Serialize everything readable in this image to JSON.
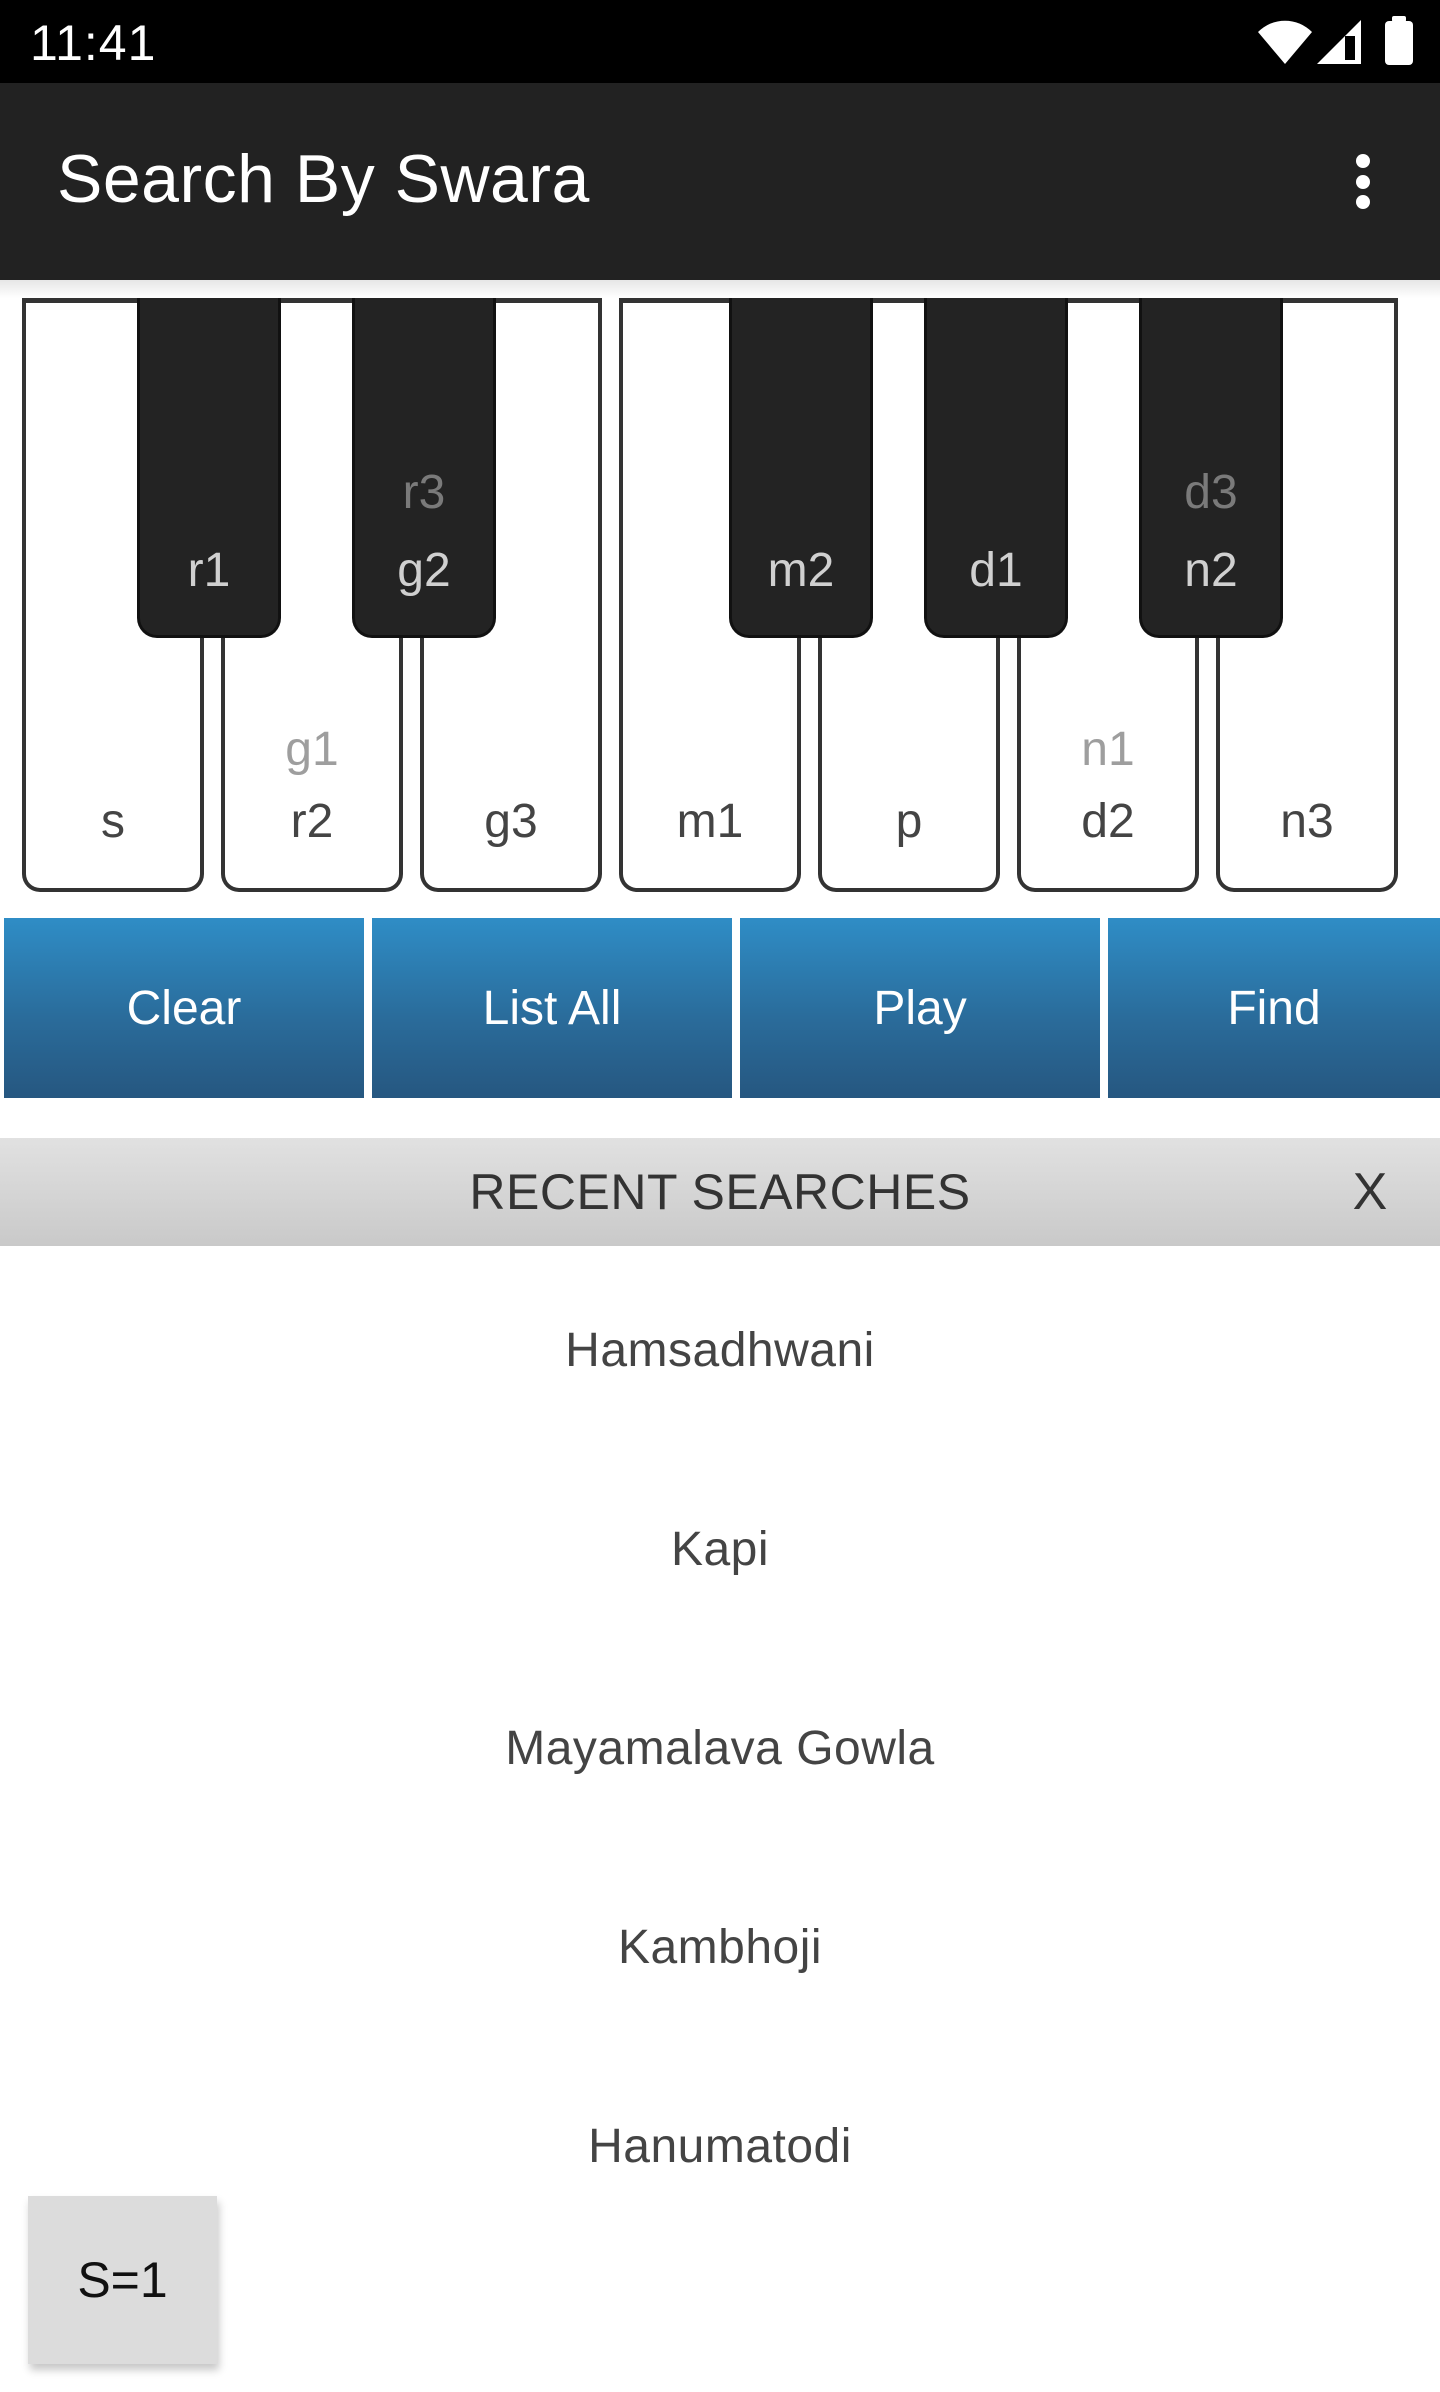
{
  "status_bar": {
    "time": "11:41",
    "icons": [
      "wifi-icon",
      "cell-signal-icon",
      "battery-icon"
    ]
  },
  "app_bar": {
    "title": "Search By Swara",
    "menu_icon": "more-vert-icon"
  },
  "keyboard": {
    "white_keys": [
      {
        "label": "s",
        "alt": ""
      },
      {
        "label": "r2",
        "alt": "g1"
      },
      {
        "label": "g3",
        "alt": ""
      },
      {
        "label": "m1",
        "alt": ""
      },
      {
        "label": "p",
        "alt": ""
      },
      {
        "label": "d2",
        "alt": "n1"
      },
      {
        "label": "n3",
        "alt": ""
      }
    ],
    "black_keys": [
      {
        "label": "r1",
        "alt": ""
      },
      {
        "label": "g2",
        "alt": "r3"
      },
      {
        "label": "m2",
        "alt": ""
      },
      {
        "label": "d1",
        "alt": ""
      },
      {
        "label": "n2",
        "alt": "d3"
      }
    ]
  },
  "actions": {
    "clear": "Clear",
    "list_all": "List All",
    "play": "Play",
    "find": "Find"
  },
  "recent_searches": {
    "title": "RECENT SEARCHES",
    "close_label": "X",
    "items": [
      "Hamsadhwani",
      "Kapi",
      "Mayamalava Gowla",
      "Kambhoji",
      "Hanumatodi"
    ]
  },
  "sruti_button": {
    "label": "S=1"
  },
  "colors": {
    "app_bar": "#222222",
    "button_top": "#2f8dc6",
    "button_bottom": "#265780",
    "black_key": "#232323"
  }
}
